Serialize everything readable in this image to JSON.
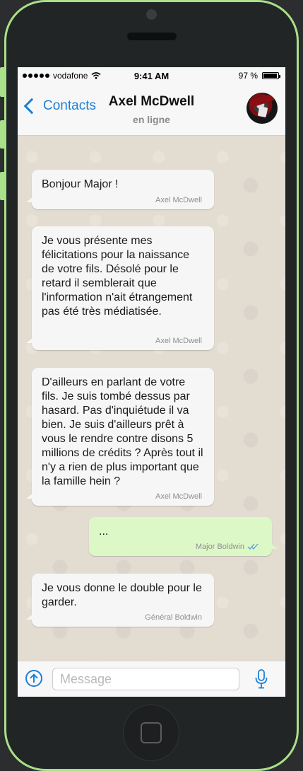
{
  "status_bar": {
    "carrier": "vodafone",
    "time": "9:41 AM",
    "battery_label": "97 %",
    "battery_level": 0.97
  },
  "header": {
    "back_label": "Contacts",
    "contact_name": "Axel McDwell",
    "contact_status": "en ligne"
  },
  "messages": [
    {
      "direction": "in",
      "text": "Bonjour Major !",
      "sender": "Axel McDwell"
    },
    {
      "direction": "in",
      "text": "Je vous présente mes félicitations pour la naissance de votre fils. Désolé pour le retard il semblerait que l'information n'ait étrangement pas été très médiatisée.",
      "sender": "Axel McDwell"
    },
    {
      "direction": "in",
      "text": "D'ailleurs en parlant de votre fils. Je suis tombé dessus par hasard. Pas d'inquiétude il va bien. Je suis d'ailleurs prêt à vous le rendre contre disons 5 millions de crédits ? Après tout il n'y a rien de plus important que la famille hein ?",
      "sender": "Axel McDwell"
    },
    {
      "direction": "out",
      "text": "...",
      "sender": "Major Boldwin",
      "read": true
    },
    {
      "direction": "in",
      "text": "Je vous donne le double pour le garder.",
      "sender": "Général Boldwin"
    }
  ],
  "input": {
    "placeholder": "Message"
  },
  "icons": {
    "back": "chevron-left-icon",
    "wifi": "wifi-icon",
    "battery": "battery-icon",
    "upload": "upload-arrow-icon",
    "mic": "microphone-icon",
    "read_receipt": "double-check-icon"
  },
  "colors": {
    "accent": "#1d7fd6",
    "phone_trim": "#a9e08a",
    "incoming_bubble": "#f6f6f6",
    "outgoing_bubble": "#dcf8c6"
  }
}
